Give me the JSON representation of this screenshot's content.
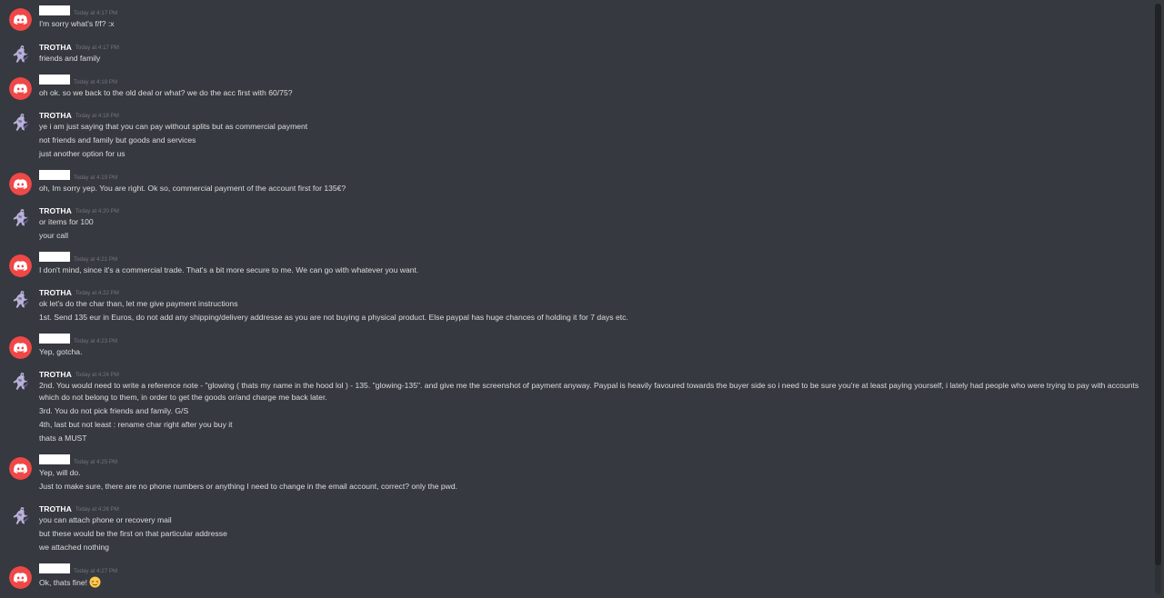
{
  "colors": {
    "background": "#36393f",
    "discord_red": "#f04747",
    "username": "#ffffff",
    "timestamp": "#72767d",
    "message_text": "#dcddde"
  },
  "icons": {
    "discord_default_avatar": "discord-logo-icon",
    "trotha_avatar": "mewtwo-figure-icon",
    "emoji": "relieved-face-emoji"
  },
  "messages": [
    {
      "author": "",
      "redacted": true,
      "time": "Today at 4:17 PM",
      "lines": [
        "I'm sorry what's f/f? :x"
      ]
    },
    {
      "author": "TROTHA",
      "redacted": false,
      "time": "Today at 4:17 PM",
      "lines": [
        "friends and family"
      ]
    },
    {
      "author": "",
      "redacted": true,
      "time": "Today at 4:18 PM",
      "lines": [
        "oh ok. so we back to the old deal or what? we do the acc first with 60/75?"
      ]
    },
    {
      "author": "TROTHA",
      "redacted": false,
      "time": "Today at 4:18 PM",
      "lines": [
        "ye i am just saying that you can pay without splits but as commercial payment",
        "not friends and family but goods and services",
        "just another option for us"
      ]
    },
    {
      "author": "",
      "redacted": true,
      "time": "Today at 4:19 PM",
      "lines": [
        "oh, Im sorry yep. You are right. Ok so, commercial payment of the account first for 135€?"
      ]
    },
    {
      "author": "TROTHA",
      "redacted": false,
      "time": "Today at 4:20 PM",
      "lines": [
        "or items for 100",
        "your call"
      ]
    },
    {
      "author": "",
      "redacted": true,
      "time": "Today at 4:21 PM",
      "lines": [
        "I don't mind, since it's a commercial trade. That's a bit more secure to me. We can go with whatever you want."
      ]
    },
    {
      "author": "TROTHA",
      "redacted": false,
      "time": "Today at 4:22 PM",
      "lines": [
        "ok let's do the char than, let me give payment instructions",
        "1st. Send 135 eur in Euros, do not add any shipping/delivery addresse as you are not buying a physical product. Else paypal has huge chances of holding it for 7 days etc."
      ]
    },
    {
      "author": "",
      "redacted": true,
      "time": "Today at 4:23 PM",
      "lines": [
        "Yep, gotcha."
      ]
    },
    {
      "author": "TROTHA",
      "redacted": false,
      "time": "Today at 4:24 PM",
      "lines": [
        "2nd. You would need to write a reference note - \"glowing ( thats my name in the hood lol ) - 135. \"glowing-135\". and give me the screenshot of payment anyway. Paypal is heavily favoured towards the buyer side so i need to be sure you're at least paying yourself, i lately had people who were trying to pay with accounts which do not belong to them, in order to get the goods or/and charge me back later.",
        "3rd. You do not pick friends and family. G/S",
        "4th, last but not least : rename char right after you buy it",
        "thats a MUST"
      ]
    },
    {
      "author": "",
      "redacted": true,
      "time": "Today at 4:25 PM",
      "lines": [
        "Yep, will do.",
        "Just to make sure, there are no phone numbers or anything I need to change in the email account, correct? only the pwd."
      ]
    },
    {
      "author": "TROTHA",
      "redacted": false,
      "time": "Today at 4:26 PM",
      "lines": [
        "you can attach phone or recovery mail",
        "but these would be the first on that particular addresse",
        "we attached nothing"
      ]
    },
    {
      "author": "",
      "redacted": true,
      "time": "Today at 4:27 PM",
      "lines": [
        "Ok, thats fine!"
      ],
      "emoji": true
    }
  ]
}
